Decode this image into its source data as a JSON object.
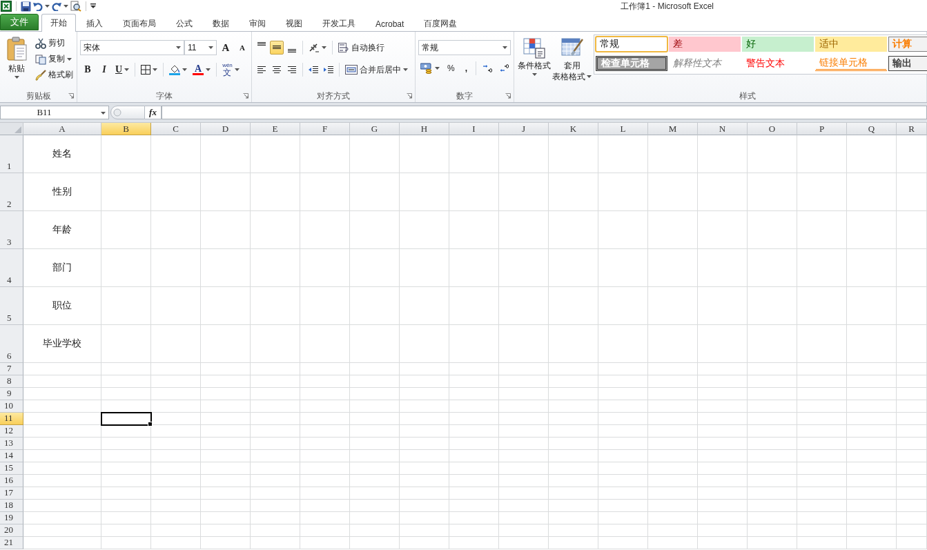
{
  "window": {
    "title": "工作簿1 - Microsoft Excel"
  },
  "tabs": [
    {
      "label": "文件",
      "kind": "file",
      "selected": false
    },
    {
      "label": "开始",
      "kind": "tab",
      "selected": true
    },
    {
      "label": "插入",
      "kind": "tab",
      "selected": false
    },
    {
      "label": "页面布局",
      "kind": "tab",
      "selected": false
    },
    {
      "label": "公式",
      "kind": "tab",
      "selected": false
    },
    {
      "label": "数据",
      "kind": "tab",
      "selected": false
    },
    {
      "label": "审阅",
      "kind": "tab",
      "selected": false
    },
    {
      "label": "视图",
      "kind": "tab",
      "selected": false
    },
    {
      "label": "开发工具",
      "kind": "tab",
      "selected": false
    },
    {
      "label": "Acrobat",
      "kind": "tab",
      "selected": false
    },
    {
      "label": "百度网盘",
      "kind": "tab",
      "selected": false
    }
  ],
  "clipboard": {
    "title": "剪贴板",
    "paste": "粘贴",
    "cut": "剪切",
    "copy": "复制",
    "format_painter": "格式刷"
  },
  "font": {
    "title": "字体",
    "font_name": "宋体",
    "font_size": "11",
    "grow": "A",
    "shrink": "A",
    "bold": "B",
    "italic": "I",
    "underline": "U",
    "font_color": "A",
    "phonetic_top": "wén",
    "phonetic": "文"
  },
  "alignment": {
    "title": "对齐方式",
    "vertical": [
      {
        "selected": false
      },
      {
        "selected": true
      },
      {
        "selected": false
      }
    ],
    "wrap": "自动换行",
    "merge": "合并后居中"
  },
  "number": {
    "title": "数字",
    "format": "常规",
    "percent": "%",
    "comma": ","
  },
  "styles": {
    "title": "样式",
    "conditional": "条件格式",
    "table_format_1": "套用",
    "table_format_2": "表格格式",
    "gallery": [
      {
        "label": "常规",
        "kind": "normal",
        "selected": true
      },
      {
        "label": "差",
        "kind": "bad",
        "selected": false
      },
      {
        "label": "好",
        "kind": "good",
        "selected": false
      },
      {
        "label": "适中",
        "kind": "neutral",
        "selected": false
      },
      {
        "label": "计算",
        "kind": "calc",
        "selected": false
      },
      {
        "label": "检查单元格",
        "kind": "check",
        "selected": false
      },
      {
        "label": "解释性文本",
        "kind": "explanatory",
        "selected": false
      },
      {
        "label": "警告文本",
        "kind": "warning",
        "selected": false
      },
      {
        "label": "链接单元格",
        "kind": "linked",
        "selected": false
      },
      {
        "label": "输出",
        "kind": "output",
        "selected": false
      }
    ]
  },
  "formula_bar": {
    "name_box": "B11",
    "fx": "fx"
  },
  "sheet": {
    "columns": [
      {
        "label": "A",
        "selected": false
      },
      {
        "label": "B",
        "selected": true
      },
      {
        "label": "C",
        "selected": false
      },
      {
        "label": "D",
        "selected": false
      },
      {
        "label": "E",
        "selected": false
      },
      {
        "label": "F",
        "selected": false
      },
      {
        "label": "G",
        "selected": false
      },
      {
        "label": "H",
        "selected": false
      },
      {
        "label": "I",
        "selected": false
      },
      {
        "label": "J",
        "selected": false
      },
      {
        "label": "K",
        "selected": false
      },
      {
        "label": "L",
        "selected": false
      },
      {
        "label": "M",
        "selected": false
      },
      {
        "label": "N",
        "selected": false
      },
      {
        "label": "O",
        "selected": false
      },
      {
        "label": "P",
        "selected": false
      },
      {
        "label": "Q",
        "selected": false
      },
      {
        "label": "R",
        "selected": false
      }
    ],
    "rows": [
      {
        "label": "1",
        "kind": "tall",
        "selected": false,
        "cells": [
          "姓名"
        ]
      },
      {
        "label": "2",
        "kind": "tall",
        "selected": false,
        "cells": [
          "性别"
        ]
      },
      {
        "label": "3",
        "kind": "tall",
        "selected": false,
        "cells": [
          "年龄"
        ]
      },
      {
        "label": "4",
        "kind": "tall",
        "selected": false,
        "cells": [
          "部门"
        ]
      },
      {
        "label": "5",
        "kind": "tall",
        "selected": false,
        "cells": [
          "职位"
        ]
      },
      {
        "label": "6",
        "kind": "tall",
        "selected": false,
        "cells": [
          "毕业学校"
        ]
      },
      {
        "label": "7",
        "kind": "normal",
        "selected": false,
        "cells": []
      },
      {
        "label": "8",
        "kind": "normal",
        "selected": false,
        "cells": []
      },
      {
        "label": "9",
        "kind": "normal",
        "selected": false,
        "cells": []
      },
      {
        "label": "10",
        "kind": "normal",
        "selected": false,
        "cells": []
      },
      {
        "label": "11",
        "kind": "normal",
        "selected": true,
        "cells": []
      },
      {
        "label": "12",
        "kind": "normal",
        "selected": false,
        "cells": []
      },
      {
        "label": "13",
        "kind": "normal",
        "selected": false,
        "cells": []
      },
      {
        "label": "14",
        "kind": "normal",
        "selected": false,
        "cells": []
      },
      {
        "label": "15",
        "kind": "normal",
        "selected": false,
        "cells": []
      },
      {
        "label": "16",
        "kind": "normal",
        "selected": false,
        "cells": []
      },
      {
        "label": "17",
        "kind": "normal",
        "selected": false,
        "cells": []
      },
      {
        "label": "18",
        "kind": "normal",
        "selected": false,
        "cells": []
      },
      {
        "label": "19",
        "kind": "normal",
        "selected": false,
        "cells": []
      },
      {
        "label": "20",
        "kind": "normal",
        "selected": false,
        "cells": []
      },
      {
        "label": "21",
        "kind": "normal",
        "selected": false,
        "cells": []
      }
    ]
  }
}
